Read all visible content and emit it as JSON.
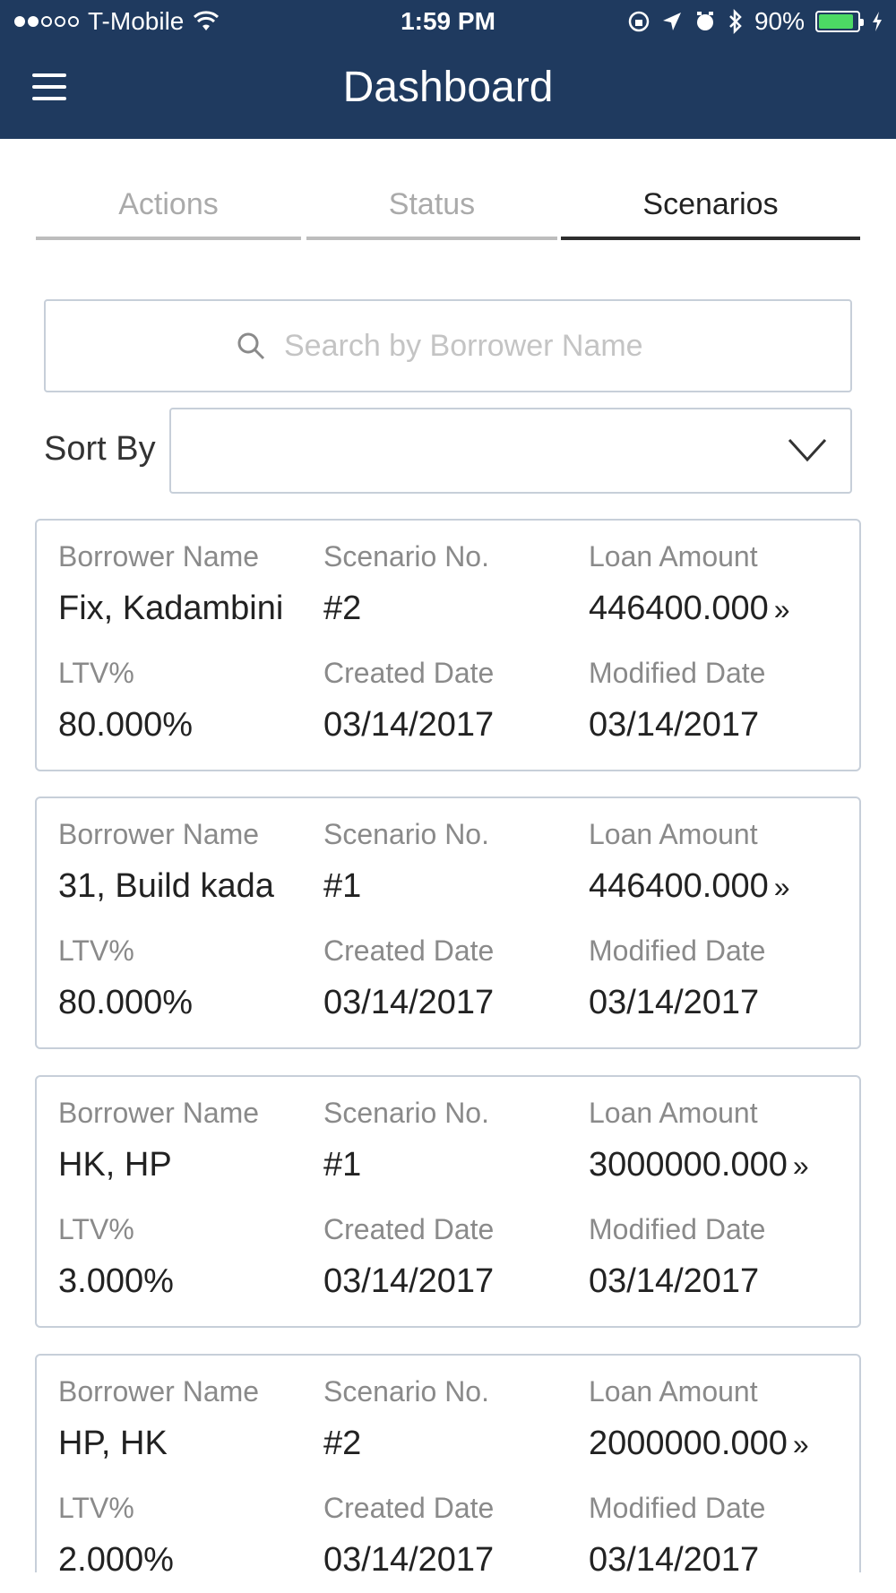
{
  "status_bar": {
    "carrier": "T-Mobile",
    "time": "1:59 PM",
    "battery": "90%",
    "battery_level": 0.9,
    "signal_bars": 2
  },
  "header": {
    "title": "Dashboard",
    "menu_icon": "hamburger-icon",
    "color": "#1f3a5f"
  },
  "tabs": [
    {
      "label": "Actions",
      "active": false
    },
    {
      "label": "Status",
      "active": false
    },
    {
      "label": "Scenarios",
      "active": true
    }
  ],
  "search": {
    "placeholder": "Search by Borrower Name",
    "value": "",
    "icon": "search-icon"
  },
  "sort": {
    "label": "Sort By",
    "value": "",
    "icon": "chevron-down-icon"
  },
  "labels": {
    "borrower": "Borrower Name",
    "scenario": "Scenario No.",
    "loan": "Loan Amount",
    "ltv": "LTV%",
    "created": "Created Date",
    "modified": "Modified Date",
    "arrow": "»"
  },
  "cards": [
    {
      "borrower": "Fix, Kadambini",
      "scenario": "#2",
      "loan": "446400.000",
      "ltv": "80.000%",
      "created": "03/14/2017",
      "modified": "03/14/2017"
    },
    {
      "borrower": "31, Build kada",
      "scenario": "#1",
      "loan": "446400.000",
      "ltv": "80.000%",
      "created": "03/14/2017",
      "modified": "03/14/2017"
    },
    {
      "borrower": "HK, HP",
      "scenario": "#1",
      "loan": "3000000.000",
      "ltv": "3.000%",
      "created": "03/14/2017",
      "modified": "03/14/2017"
    },
    {
      "borrower": "HP, HK",
      "scenario": "#2",
      "loan": "2000000.000",
      "ltv": "2.000%",
      "created": "03/14/2017",
      "modified": "03/14/2017"
    }
  ]
}
